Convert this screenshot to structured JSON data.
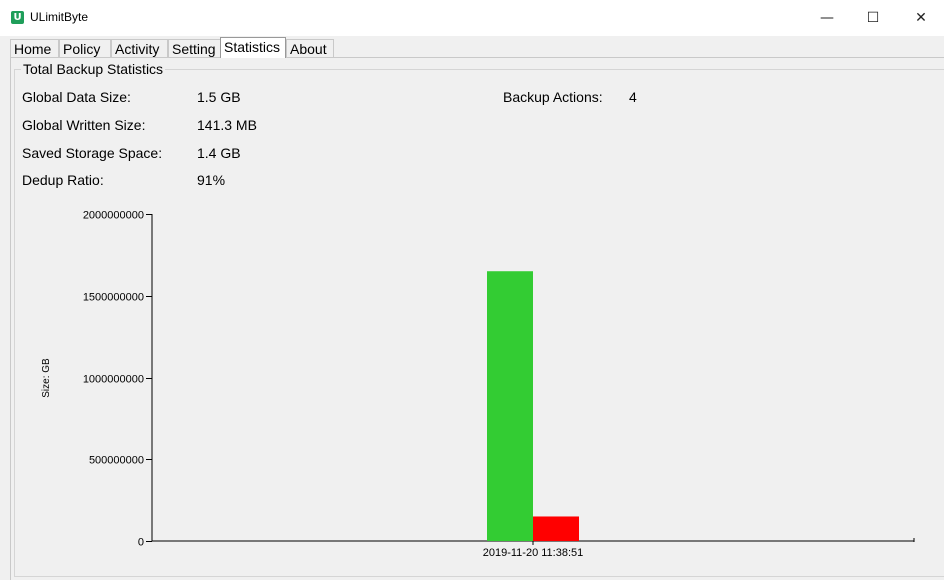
{
  "window": {
    "title": "ULimitByte",
    "icon": "app-logo-icon",
    "controls": {
      "minimize": "—",
      "maximize": "☐",
      "close": "✕"
    }
  },
  "tabs": [
    "Home",
    "Policy",
    "Activity",
    "Setting",
    "Statistics",
    "About"
  ],
  "active_tab": "Statistics",
  "stats": {
    "group_title": "Total Backup Statistics",
    "global_data_size_label": "Global Data Size:",
    "global_data_size": "1.5 GB",
    "global_written_size_label": "Global Written Size:",
    "global_written_size": "141.3 MB",
    "saved_storage_label": "Saved Storage Space:",
    "saved_storage": "1.4 GB",
    "dedup_ratio_label": "Dedup Ratio:",
    "dedup_ratio": "91%",
    "backup_actions_label": "Backup Actions:",
    "backup_actions": "4"
  },
  "chart_data": {
    "type": "bar",
    "categories": [
      "2019-11-20 11:38:51"
    ],
    "series": [
      {
        "values": [
          1650000000
        ],
        "color": "#33cc33"
      },
      {
        "values": [
          150000000
        ],
        "color": "#ff0000"
      }
    ],
    "ylabel": "Size: GB",
    "xlabel": "",
    "ylim": [
      0,
      2000000000
    ],
    "yticks": [
      0,
      500000000,
      1000000000,
      1500000000,
      2000000000
    ],
    "grid": false
  }
}
